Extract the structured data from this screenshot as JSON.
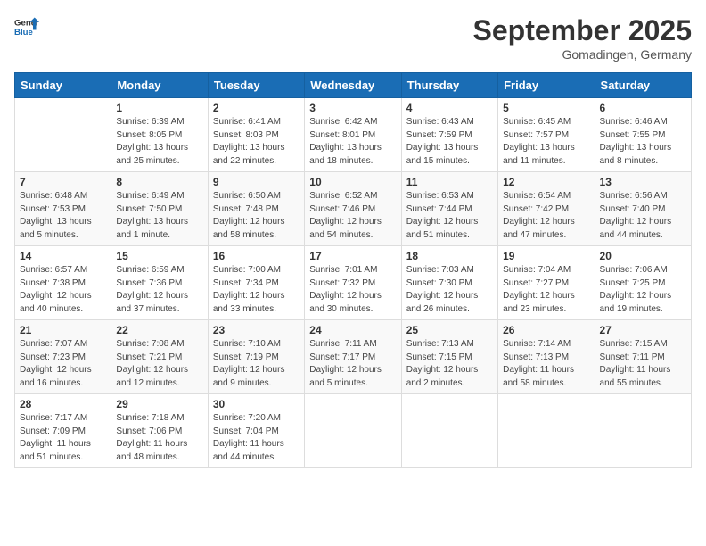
{
  "header": {
    "logo_general": "General",
    "logo_blue": "Blue",
    "month_year": "September 2025",
    "location": "Gomadingen, Germany"
  },
  "days_of_week": [
    "Sunday",
    "Monday",
    "Tuesday",
    "Wednesday",
    "Thursday",
    "Friday",
    "Saturday"
  ],
  "weeks": [
    [
      {
        "day": null
      },
      {
        "day": "1",
        "sunrise": "Sunrise: 6:39 AM",
        "sunset": "Sunset: 8:05 PM",
        "daylight": "Daylight: 13 hours and 25 minutes."
      },
      {
        "day": "2",
        "sunrise": "Sunrise: 6:41 AM",
        "sunset": "Sunset: 8:03 PM",
        "daylight": "Daylight: 13 hours and 22 minutes."
      },
      {
        "day": "3",
        "sunrise": "Sunrise: 6:42 AM",
        "sunset": "Sunset: 8:01 PM",
        "daylight": "Daylight: 13 hours and 18 minutes."
      },
      {
        "day": "4",
        "sunrise": "Sunrise: 6:43 AM",
        "sunset": "Sunset: 7:59 PM",
        "daylight": "Daylight: 13 hours and 15 minutes."
      },
      {
        "day": "5",
        "sunrise": "Sunrise: 6:45 AM",
        "sunset": "Sunset: 7:57 PM",
        "daylight": "Daylight: 13 hours and 11 minutes."
      },
      {
        "day": "6",
        "sunrise": "Sunrise: 6:46 AM",
        "sunset": "Sunset: 7:55 PM",
        "daylight": "Daylight: 13 hours and 8 minutes."
      }
    ],
    [
      {
        "day": "7",
        "sunrise": "Sunrise: 6:48 AM",
        "sunset": "Sunset: 7:53 PM",
        "daylight": "Daylight: 13 hours and 5 minutes."
      },
      {
        "day": "8",
        "sunrise": "Sunrise: 6:49 AM",
        "sunset": "Sunset: 7:50 PM",
        "daylight": "Daylight: 13 hours and 1 minute."
      },
      {
        "day": "9",
        "sunrise": "Sunrise: 6:50 AM",
        "sunset": "Sunset: 7:48 PM",
        "daylight": "Daylight: 12 hours and 58 minutes."
      },
      {
        "day": "10",
        "sunrise": "Sunrise: 6:52 AM",
        "sunset": "Sunset: 7:46 PM",
        "daylight": "Daylight: 12 hours and 54 minutes."
      },
      {
        "day": "11",
        "sunrise": "Sunrise: 6:53 AM",
        "sunset": "Sunset: 7:44 PM",
        "daylight": "Daylight: 12 hours and 51 minutes."
      },
      {
        "day": "12",
        "sunrise": "Sunrise: 6:54 AM",
        "sunset": "Sunset: 7:42 PM",
        "daylight": "Daylight: 12 hours and 47 minutes."
      },
      {
        "day": "13",
        "sunrise": "Sunrise: 6:56 AM",
        "sunset": "Sunset: 7:40 PM",
        "daylight": "Daylight: 12 hours and 44 minutes."
      }
    ],
    [
      {
        "day": "14",
        "sunrise": "Sunrise: 6:57 AM",
        "sunset": "Sunset: 7:38 PM",
        "daylight": "Daylight: 12 hours and 40 minutes."
      },
      {
        "day": "15",
        "sunrise": "Sunrise: 6:59 AM",
        "sunset": "Sunset: 7:36 PM",
        "daylight": "Daylight: 12 hours and 37 minutes."
      },
      {
        "day": "16",
        "sunrise": "Sunrise: 7:00 AM",
        "sunset": "Sunset: 7:34 PM",
        "daylight": "Daylight: 12 hours and 33 minutes."
      },
      {
        "day": "17",
        "sunrise": "Sunrise: 7:01 AM",
        "sunset": "Sunset: 7:32 PM",
        "daylight": "Daylight: 12 hours and 30 minutes."
      },
      {
        "day": "18",
        "sunrise": "Sunrise: 7:03 AM",
        "sunset": "Sunset: 7:30 PM",
        "daylight": "Daylight: 12 hours and 26 minutes."
      },
      {
        "day": "19",
        "sunrise": "Sunrise: 7:04 AM",
        "sunset": "Sunset: 7:27 PM",
        "daylight": "Daylight: 12 hours and 23 minutes."
      },
      {
        "day": "20",
        "sunrise": "Sunrise: 7:06 AM",
        "sunset": "Sunset: 7:25 PM",
        "daylight": "Daylight: 12 hours and 19 minutes."
      }
    ],
    [
      {
        "day": "21",
        "sunrise": "Sunrise: 7:07 AM",
        "sunset": "Sunset: 7:23 PM",
        "daylight": "Daylight: 12 hours and 16 minutes."
      },
      {
        "day": "22",
        "sunrise": "Sunrise: 7:08 AM",
        "sunset": "Sunset: 7:21 PM",
        "daylight": "Daylight: 12 hours and 12 minutes."
      },
      {
        "day": "23",
        "sunrise": "Sunrise: 7:10 AM",
        "sunset": "Sunset: 7:19 PM",
        "daylight": "Daylight: 12 hours and 9 minutes."
      },
      {
        "day": "24",
        "sunrise": "Sunrise: 7:11 AM",
        "sunset": "Sunset: 7:17 PM",
        "daylight": "Daylight: 12 hours and 5 minutes."
      },
      {
        "day": "25",
        "sunrise": "Sunrise: 7:13 AM",
        "sunset": "Sunset: 7:15 PM",
        "daylight": "Daylight: 12 hours and 2 minutes."
      },
      {
        "day": "26",
        "sunrise": "Sunrise: 7:14 AM",
        "sunset": "Sunset: 7:13 PM",
        "daylight": "Daylight: 11 hours and 58 minutes."
      },
      {
        "day": "27",
        "sunrise": "Sunrise: 7:15 AM",
        "sunset": "Sunset: 7:11 PM",
        "daylight": "Daylight: 11 hours and 55 minutes."
      }
    ],
    [
      {
        "day": "28",
        "sunrise": "Sunrise: 7:17 AM",
        "sunset": "Sunset: 7:09 PM",
        "daylight": "Daylight: 11 hours and 51 minutes."
      },
      {
        "day": "29",
        "sunrise": "Sunrise: 7:18 AM",
        "sunset": "Sunset: 7:06 PM",
        "daylight": "Daylight: 11 hours and 48 minutes."
      },
      {
        "day": "30",
        "sunrise": "Sunrise: 7:20 AM",
        "sunset": "Sunset: 7:04 PM",
        "daylight": "Daylight: 11 hours and 44 minutes."
      },
      {
        "day": null
      },
      {
        "day": null
      },
      {
        "day": null
      },
      {
        "day": null
      }
    ]
  ]
}
